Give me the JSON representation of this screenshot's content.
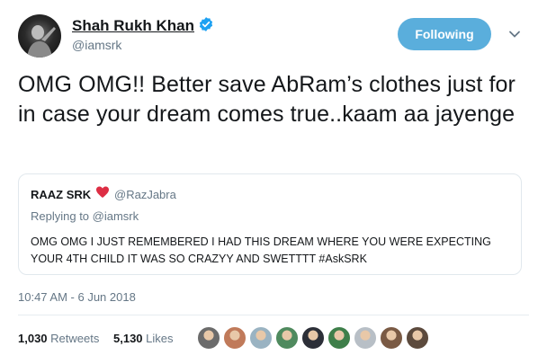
{
  "author": {
    "display_name": "Shah Rukh Khan",
    "handle": "@iamsrk",
    "verified": true
  },
  "follow_button": {
    "label": "Following"
  },
  "tweet": {
    "text": "OMG OMG!! Better save AbRam’s clothes just for in case your dream comes true..kaam aa jayenge",
    "timestamp": "10:47 AM - 6 Jun 2018"
  },
  "quoted": {
    "display_name": "RAAZ SRK",
    "handle": "@RazJabra",
    "replying_to": "Replying to @iamsrk",
    "text": "OMG OMG I JUST REMEMBERED I HAD THIS DREAM WHERE YOU WERE EXPECTING YOUR 4TH CHILD IT WAS SO CRAZYY AND SWETTTT #AskSRK"
  },
  "stats": {
    "retweets_count": "1,030",
    "retweets_label": "Retweets",
    "likes_count": "5,130",
    "likes_label": "Likes"
  },
  "likers": [
    {
      "color": "#6b6b6b"
    },
    {
      "color": "#c07a5a"
    },
    {
      "color": "#9ab3c2"
    },
    {
      "color": "#4f8a5e"
    },
    {
      "color": "#2c2f38"
    },
    {
      "color": "#3e7f4a"
    },
    {
      "color": "#b8bfc6"
    },
    {
      "color": "#7a5a44"
    },
    {
      "color": "#5c4a3d"
    }
  ],
  "colors": {
    "accent": "#1da1f2",
    "follow_button_bg": "#5aaedc",
    "secondary_text": "#657786",
    "heart": "#e0245e"
  }
}
